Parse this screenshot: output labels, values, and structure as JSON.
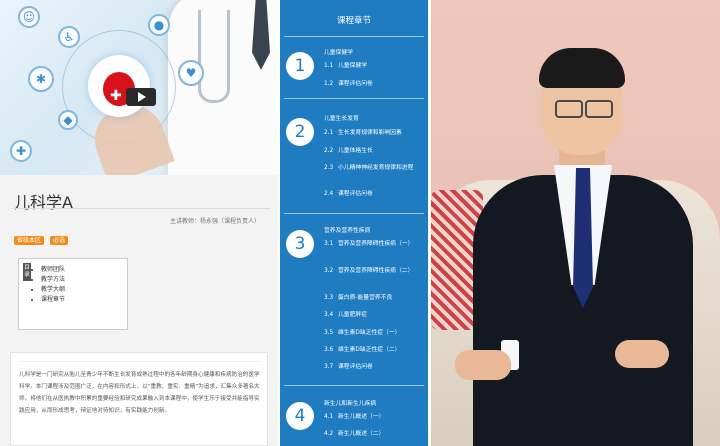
{
  "course": {
    "title": "儿科学A",
    "teacher": "主讲教师：杨永强（课程负责人）",
    "tags": [
      "省级本区",
      "必选"
    ],
    "toc_label": "目录",
    "toc_items": [
      "教师团队",
      "教学方法",
      "教学大纲",
      "课程章节"
    ],
    "description": "儿科学是一门研究从胎儿至青少年不断生长发育成熟过程中的各年龄期身心健康和疾病防治的医学科学。本门课程涉及范围广泛，在内容和形式上，以“重教、重实、重精”为追求，汇集众多著名大师。将他们在从医执教中积累的重要经验和研究成果融入到本课程中，使学生乐于接受并能指导实践应用，从而形成思考，辩证地对待知识，有实践能力创新。"
  },
  "chapters_panel": {
    "title": "课程章节",
    "chapters": [
      {
        "num": "1",
        "name": "儿童保健学",
        "items": [
          {
            "n": "1.1",
            "t": "儿童保健学"
          },
          {
            "n": "1.2",
            "t": "课程评估问卷"
          }
        ]
      },
      {
        "num": "2",
        "name": "儿童生长发育",
        "items": [
          {
            "n": "2.1",
            "t": "生长发育规律和影响因素"
          },
          {
            "n": "2.2",
            "t": "儿童体格生长"
          },
          {
            "n": "2.3",
            "t": "小儿精神神经发育规律和进程"
          },
          {
            "n": "2.4",
            "t": "课程评估问卷"
          }
        ]
      },
      {
        "num": "3",
        "name": "营养及营养性疾病",
        "items": [
          {
            "n": "3.1",
            "t": "营养及营养障碍性疾病（一）"
          },
          {
            "n": "3.2",
            "t": "营养及营养障碍性疾病（二）"
          },
          {
            "n": "3.3",
            "t": "蛋白质-能量营养不良"
          },
          {
            "n": "3.4",
            "t": "儿童肥胖症"
          },
          {
            "n": "3.5",
            "t": "维生素D缺乏性症（一）"
          },
          {
            "n": "3.6",
            "t": "维生素D缺乏性症（二）"
          },
          {
            "n": "3.7",
            "t": "课程评估问卷"
          }
        ]
      },
      {
        "num": "4",
        "name": "新生儿和新生儿疾病",
        "items": [
          {
            "n": "4.1",
            "t": "新生儿概述（一）"
          },
          {
            "n": "4.2",
            "t": "新生儿概述（二）"
          }
        ]
      }
    ]
  },
  "colors": {
    "panel_blue": "#1f7cc0",
    "tag_orange": "#f28b1a"
  }
}
